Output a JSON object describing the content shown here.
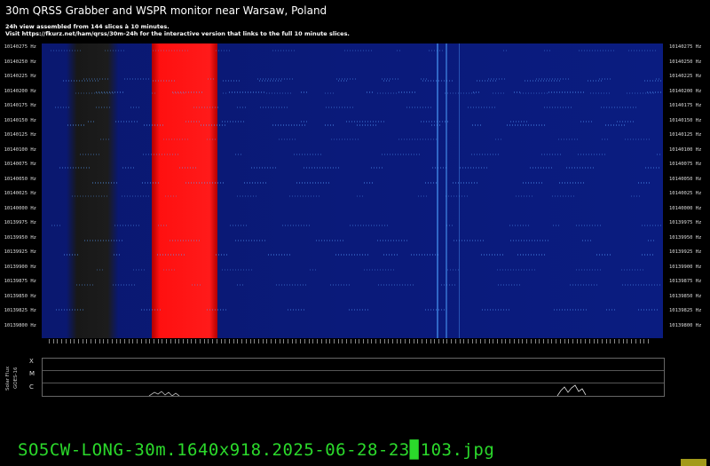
{
  "header": {
    "title": "30m QRSS Grabber and WSPR monitor near Warsaw, Poland",
    "line1": "24h view assembled from 144 slices à 10 minutes.",
    "line2": "Visit https://fkurz.net/ham/qrss/30m-24h for the interactive version that links to the full 10 minute slices."
  },
  "freq_axis": {
    "labels": [
      "10140275 Hz",
      "10140250 Hz",
      "10140225 Hz",
      "10140200 Hz",
      "10140175 Hz",
      "10140150 Hz",
      "10140125 Hz",
      "10140100 Hz",
      "10140075 Hz",
      "10140050 Hz",
      "10140025 Hz",
      "10140000 Hz",
      "10139975 Hz",
      "10139950 Hz",
      "10139925 Hz",
      "10139900 Hz",
      "10139875 Hz",
      "10139850 Hz",
      "10139825 Hz",
      "10139800 Hz"
    ]
  },
  "flux": {
    "side_label_1": "Solar Flux",
    "side_label_2": "GOES-16",
    "rows": [
      "X",
      "M",
      "C"
    ]
  },
  "footer": {
    "filename": "SO5CW-LONG-30m.1640x918.2025-06-28-23▉103.jpg"
  },
  "colors": {
    "background": "#000000",
    "spectrogram": "#0a1a7a",
    "noise_band": "#ff1a1a",
    "dark_band": "#1a1a1a",
    "filename": "#2bd92b"
  }
}
